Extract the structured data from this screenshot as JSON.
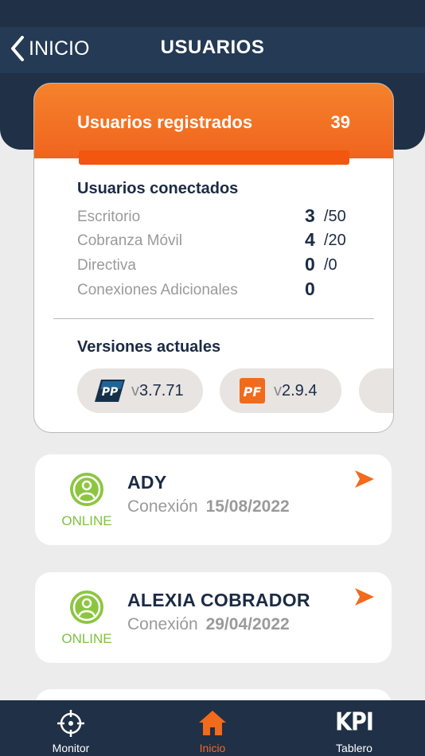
{
  "nav": {
    "back_label": "INICIO",
    "title": "USUARIOS"
  },
  "summary": {
    "registered_label": "Usuarios registrados",
    "registered_count": "39",
    "connected_title": "Usuarios conectados",
    "connected": [
      {
        "label": "Escritorio",
        "value": "3",
        "max": "/50"
      },
      {
        "label": "Cobranza Móvil",
        "value": "4",
        "max": "/20"
      },
      {
        "label": "Directiva",
        "value": "0",
        "max": "/0"
      },
      {
        "label": "Conexiones Adicionales",
        "value": "0",
        "max": ""
      }
    ],
    "versions_title": "Versiones actuales",
    "versions": [
      {
        "logo": "PP",
        "prefix": "v",
        "number": "3.7.71"
      },
      {
        "logo": "PF",
        "prefix": "v",
        "number": "2.9.4"
      }
    ]
  },
  "users": [
    {
      "name": "ADY",
      "status": "ONLINE",
      "conn_label": "Conexión",
      "date": "15/08/2022"
    },
    {
      "name": "ALEXIA COBRADOR",
      "status": "ONLINE",
      "conn_label": "Conexión",
      "date": "29/04/2022"
    }
  ],
  "tabs": [
    {
      "label": "Monitor",
      "icon": "crosshair-icon"
    },
    {
      "label": "Inicio",
      "icon": "home-icon"
    },
    {
      "label": "Tablero",
      "icon": "kpi-icon",
      "icon_text": "KPI"
    }
  ],
  "colors": {
    "navy": "#1f3047",
    "orange": "#f26a1b",
    "online": "#7ec242"
  }
}
